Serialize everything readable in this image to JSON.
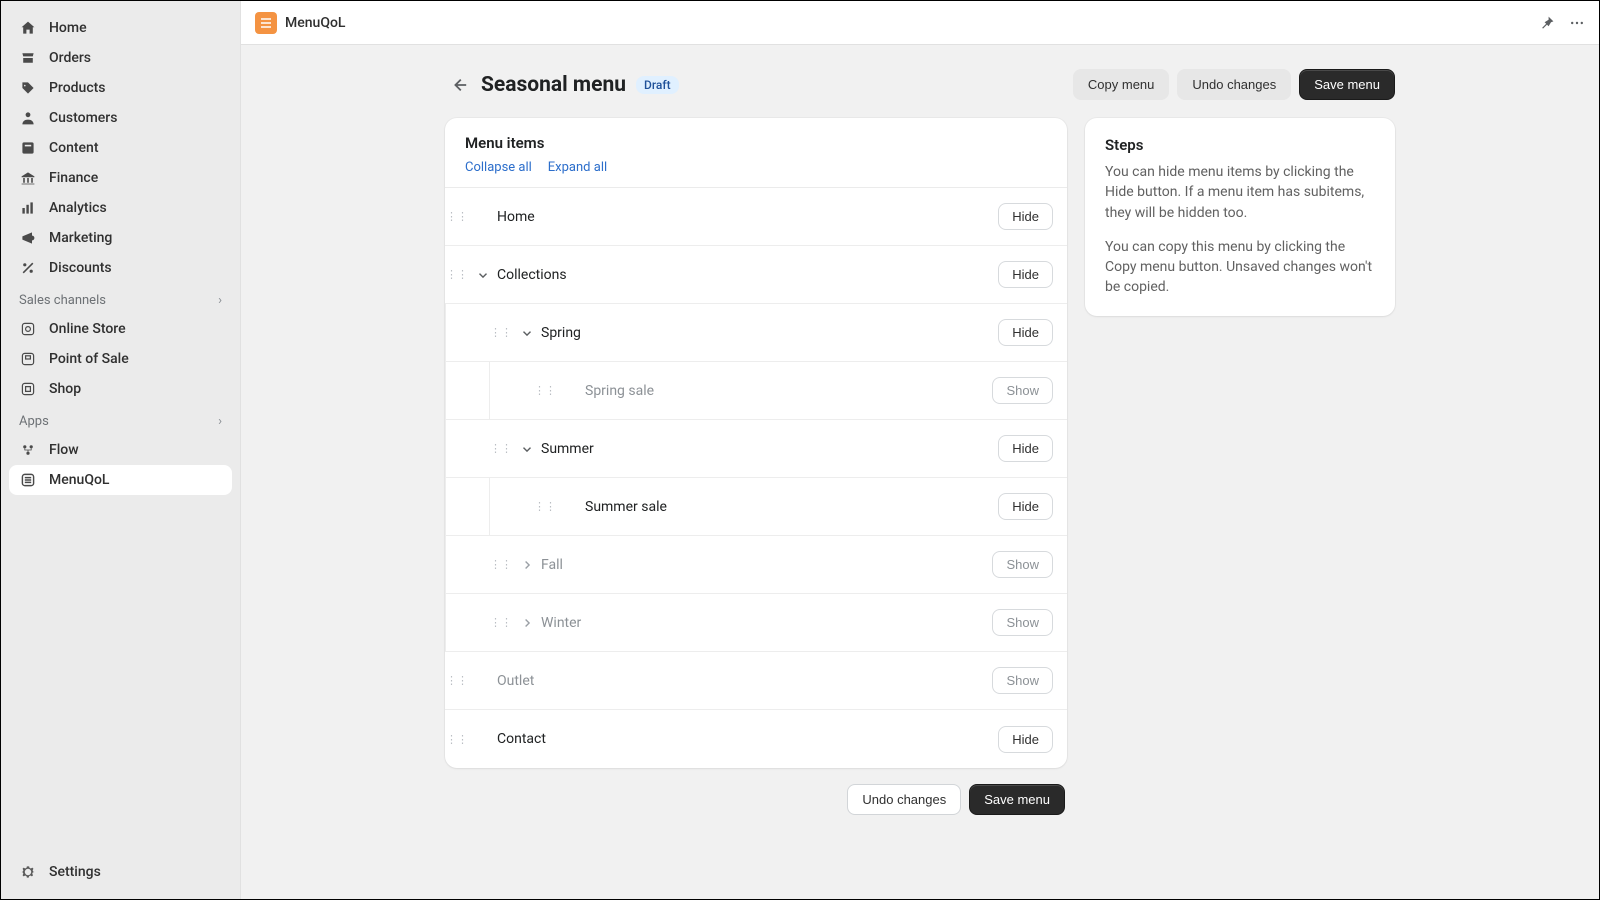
{
  "app_name": "MenuQoL",
  "sidebar": {
    "primary": [
      {
        "label": "Home",
        "icon": "home"
      },
      {
        "label": "Orders",
        "icon": "orders"
      },
      {
        "label": "Products",
        "icon": "products"
      },
      {
        "label": "Customers",
        "icon": "customers"
      },
      {
        "label": "Content",
        "icon": "content"
      },
      {
        "label": "Finance",
        "icon": "finance"
      },
      {
        "label": "Analytics",
        "icon": "analytics"
      },
      {
        "label": "Marketing",
        "icon": "marketing"
      },
      {
        "label": "Discounts",
        "icon": "discounts"
      }
    ],
    "sales_channels_label": "Sales channels",
    "channels": [
      {
        "label": "Online Store",
        "icon": "store"
      },
      {
        "label": "Point of Sale",
        "icon": "pos"
      },
      {
        "label": "Shop",
        "icon": "shop"
      }
    ],
    "apps_label": "Apps",
    "apps": [
      {
        "label": "Flow",
        "icon": "flow"
      },
      {
        "label": "MenuQoL",
        "icon": "menuqol",
        "active": true
      }
    ],
    "settings_label": "Settings"
  },
  "page": {
    "title": "Seasonal menu",
    "badge": "Draft",
    "actions": {
      "copy": "Copy menu",
      "undo": "Undo changes",
      "save": "Save menu"
    }
  },
  "menu_card": {
    "title": "Menu items",
    "collapse": "Collapse all",
    "expand": "Expand all"
  },
  "tree": {
    "hide": "Hide",
    "show": "Show",
    "items": {
      "home": "Home",
      "collections": "Collections",
      "spring": "Spring",
      "spring_sale": "Spring sale",
      "summer": "Summer",
      "summer_sale": "Summer sale",
      "fall": "Fall",
      "winter": "Winter",
      "outlet": "Outlet",
      "contact": "Contact"
    }
  },
  "steps": {
    "title": "Steps",
    "p1": "You can hide menu items by clicking the Hide button. If a menu item has subitems, they will be hidden too.",
    "p2": "You can copy this menu by clicking the Copy menu button. Unsaved changes won't be copied."
  },
  "footer": {
    "undo": "Undo changes",
    "save": "Save menu"
  }
}
